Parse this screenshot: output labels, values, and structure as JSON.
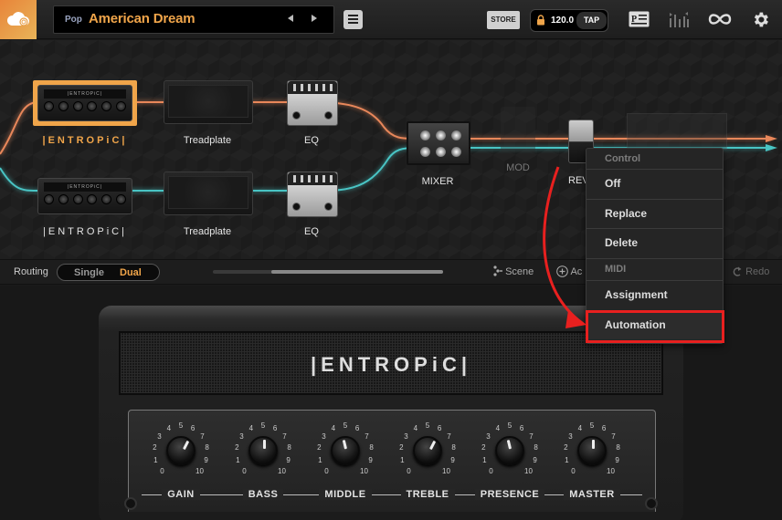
{
  "app": {
    "logo_icon": "cloud-icon"
  },
  "header": {
    "preset_category": "Pop",
    "preset_name": "American Dream",
    "prev_icon": "triangle-left-icon",
    "next_icon": "triangle-right-icon",
    "menu_icon": "hamburger-icon",
    "store_label": "STORE",
    "tempo": "120.0",
    "tap_label": "TAP",
    "lock_icon": "lock-icon",
    "icons": [
      "preset-info-icon",
      "mixer-levels-icon",
      "loop-icon",
      "gear-icon"
    ]
  },
  "chain": {
    "top_path": [
      {
        "name": "amp",
        "label": "|ENTROPiC|",
        "selected": true
      },
      {
        "name": "cab",
        "label": "Treadplate"
      },
      {
        "name": "eq",
        "label": "EQ"
      }
    ],
    "bottom_path": [
      {
        "name": "amp",
        "label": "|ENTROPiC|"
      },
      {
        "name": "cab",
        "label": "Treadplate"
      },
      {
        "name": "eq",
        "label": "EQ"
      }
    ],
    "shared": [
      {
        "name": "mixer",
        "label": "MIXER"
      },
      {
        "name": "mod",
        "label": "MOD",
        "bypassed": true
      },
      {
        "name": "reverb",
        "label": "REVE"
      },
      {
        "name": "rack",
        "label": ""
      }
    ],
    "colors": {
      "top_cable": "#e8875a",
      "bottom_cable": "#49c4c4",
      "selected": "#f0a54a"
    }
  },
  "routing": {
    "label": "Routing",
    "options": [
      "Single",
      "Dual"
    ],
    "selected": "Dual",
    "scene_label": "Scene",
    "add_label": "Ac",
    "redo_label": "Redo"
  },
  "context_menu": {
    "sections": [
      {
        "header": "Control",
        "items": [
          "Off",
          "Replace",
          "Delete"
        ]
      },
      {
        "header": "MIDI",
        "items": [
          "Assignment",
          "Automation"
        ]
      }
    ],
    "highlighted": "Automation",
    "highlight_color": "#e8201f"
  },
  "amp": {
    "name": "|ENTROPiC|",
    "scale": [
      "0",
      "1",
      "2",
      "3",
      "4",
      "5",
      "6",
      "7",
      "8",
      "9",
      "10"
    ],
    "controls": [
      {
        "label": "GAIN",
        "value": 6
      },
      {
        "label": "BASS",
        "value": 5
      },
      {
        "label": "MIDDLE",
        "value": 4.5
      },
      {
        "label": "TREBLE",
        "value": 6
      },
      {
        "label": "PRESENCE",
        "value": 4.5
      },
      {
        "label": "MASTER",
        "value": 5
      }
    ]
  }
}
